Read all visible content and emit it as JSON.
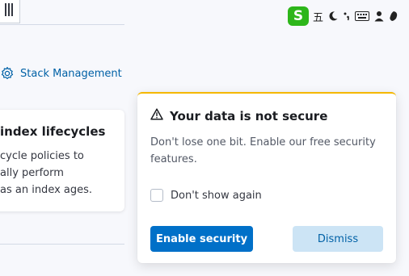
{
  "nav": {
    "stack_management": "Stack Management"
  },
  "ime": {
    "logo": "S",
    "char": "五"
  },
  "left_card": {
    "title": "index lifecycles",
    "lines": [
      "cycle policies to",
      "ally perform",
      "as an index ages."
    ]
  },
  "popup": {
    "title": "Your data is not secure",
    "body": "Don't lose one bit. Enable our free security features.",
    "checkbox_label": "Don't show again",
    "enable_label": "Enable security",
    "dismiss_label": "Dismiss"
  },
  "colors": {
    "primary": "#0070c8",
    "link": "#0061a6",
    "warning_border": "#f5b800",
    "ime_green": "#2db61a"
  }
}
